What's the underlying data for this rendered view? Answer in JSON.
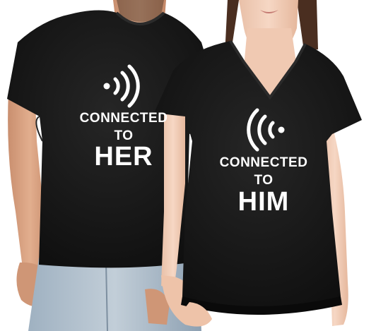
{
  "colors": {
    "background": "#ffffff",
    "shirt": "#141414",
    "skin": "#d9a07f",
    "jeans": "#8fa3b5",
    "print": "#ffffff"
  },
  "left_shirt": {
    "icon": "wifi-signal-icon",
    "line1": "CONNECTED",
    "line2": "TO",
    "line3": "HER"
  },
  "right_shirt": {
    "icon": "wifi-signal-icon",
    "line1": "CONNECTED",
    "line2": "TO",
    "line3": "HIM"
  }
}
